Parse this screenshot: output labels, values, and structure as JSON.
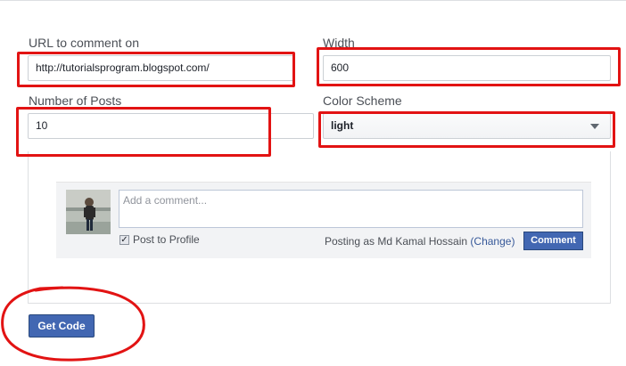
{
  "form": {
    "url_label": "URL to comment on",
    "url_value": "http://tutorialsprogram.blogspot.com/",
    "width_label": "Width",
    "width_value": "600",
    "posts_label": "Number of Posts",
    "posts_value": "10",
    "color_label": "Color Scheme",
    "color_value": "light"
  },
  "preview": {
    "comment_placeholder": "Add a comment...",
    "post_to_profile_label": "Post to Profile",
    "post_to_profile_checked": true,
    "posting_as_text": "Posting as Md Kamal Hossain",
    "change_link": "(Change)",
    "comment_button": "Comment"
  },
  "actions": {
    "get_code_label": "Get Code"
  },
  "colors": {
    "annotation_red": "#e21313",
    "button_blue": "#4267b2"
  }
}
